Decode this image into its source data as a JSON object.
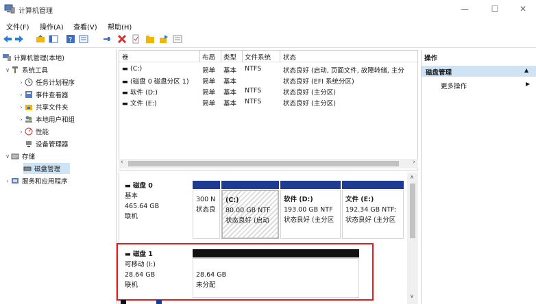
{
  "window": {
    "title": "计算机管理",
    "minimize_glyph": "—",
    "maximize_glyph": "☐",
    "close_glyph": "✕"
  },
  "menu": [
    "文件(F)",
    "操作(A)",
    "查看(V)",
    "帮助(H)"
  ],
  "toolbar": {
    "icons": [
      "back-arrow-icon",
      "forward-arrow-icon",
      "folder-up-icon",
      "console-tree-icon",
      "help-icon",
      "properties-icon",
      "pin-icon",
      "delete-icon",
      "document-icon",
      "folder-icon",
      "export-icon",
      "list-icon"
    ],
    "colors": {
      "delete": "#d32f2f",
      "folder": "#f2b705",
      "help": "#3b6fc4"
    }
  },
  "tree": {
    "root": "计算机管理(本地)",
    "items": [
      {
        "label": "系统工具",
        "level": 1,
        "expanded": true,
        "icon": "tools-icon"
      },
      {
        "label": "任务计划程序",
        "level": 2,
        "icon": "clock-icon"
      },
      {
        "label": "事件查看器",
        "level": 2,
        "icon": "event-viewer-icon"
      },
      {
        "label": "共享文件夹",
        "level": 2,
        "icon": "shared-folder-icon"
      },
      {
        "label": "本地用户和组",
        "level": 2,
        "icon": "users-icon"
      },
      {
        "label": "性能",
        "level": 2,
        "icon": "performance-icon"
      },
      {
        "label": "设备管理器",
        "level": 2,
        "icon": "device-manager-icon"
      },
      {
        "label": "存储",
        "level": 1,
        "expanded": true,
        "icon": "storage-icon"
      },
      {
        "label": "磁盘管理",
        "level": 2,
        "selected": true,
        "icon": "disk-management-icon"
      },
      {
        "label": "服务和应用程序",
        "level": 1,
        "icon": "services-icon"
      }
    ]
  },
  "volumes": {
    "headers": [
      "卷",
      "布局",
      "类型",
      "文件系统",
      "状态"
    ],
    "rows": [
      {
        "name": "(C:)",
        "layout": "简单",
        "type": "基本",
        "fs": "NTFS",
        "status": "状态良好 (启动, 页面文件, 故障转储, 主分"
      },
      {
        "name": "(磁盘 0 磁盘分区 1)",
        "layout": "简单",
        "type": "基本",
        "fs": "",
        "status": "状态良好 (EFI 系统分区)"
      },
      {
        "name": "软件 (D:)",
        "layout": "简单",
        "type": "基本",
        "fs": "NTFS",
        "status": "状态良好 (主分区)"
      },
      {
        "name": "文件 (E:)",
        "layout": "简单",
        "type": "基本",
        "fs": "NTFS",
        "status": "状态良好 (主分区)"
      }
    ]
  },
  "disks": [
    {
      "name": "磁盘 0",
      "kind": "基本",
      "size": "465.64 GB",
      "state": "联机",
      "partitions": [
        {
          "title": "",
          "size": "300 N",
          "status": "状态良"
        },
        {
          "title": "(C:)",
          "size": "80.00 GB NTF",
          "status": "状态良好 (启动"
        },
        {
          "title": "软件  (D:)",
          "size": "193.00 GB NTF",
          "status": "状态良好 (主分区"
        },
        {
          "title": "文件  (E:)",
          "size": "192.34 GB NTF:",
          "status": "状态良好 (主分区"
        }
      ]
    },
    {
      "name": "磁盘 1",
      "kind": "可移动 (I:)",
      "size": "28.64 GB",
      "state": "联机",
      "partitions": [
        {
          "title": "",
          "size": "28.64 GB",
          "status": "未分配"
        }
      ]
    }
  ],
  "actions": {
    "title": "操作",
    "section": "磁盘管理",
    "more": "更多操作"
  },
  "colors": {
    "primary_partition_bar": "#1f3a93",
    "unallocated_bar": "#111111",
    "highlight_box": "#e02020",
    "selection": "#cce4f7"
  }
}
